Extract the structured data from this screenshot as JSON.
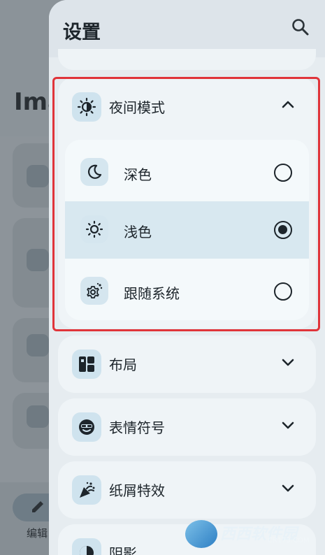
{
  "background_app": {
    "title": "Ima",
    "bottom_nav_label": "编辑"
  },
  "drawer": {
    "title": "设置",
    "search_icon": "search-icon"
  },
  "night_mode": {
    "label": "夜间模式",
    "icon": "night-mode-icon",
    "expanded": true,
    "options": [
      {
        "label": "深色",
        "icon": "moon-icon",
        "selected": false
      },
      {
        "label": "浅色",
        "icon": "sun-icon",
        "selected": true
      },
      {
        "label": "跟随系统",
        "icon": "settings-gear-icon",
        "selected": false
      }
    ]
  },
  "sections": [
    {
      "label": "布局",
      "icon": "layout-icon"
    },
    {
      "label": "表情符号",
      "icon": "emoji-icon"
    },
    {
      "label": "纸屑特效",
      "icon": "confetti-icon"
    },
    {
      "label": "阴影",
      "icon": "shadow-icon"
    }
  ],
  "watermark": {
    "brand": "西西软件园",
    "url": "CR173.COM"
  },
  "colors": {
    "highlight": "#e0343a",
    "selected_row": "#d8e8f0",
    "icon_bg": "#cfe3ee"
  }
}
